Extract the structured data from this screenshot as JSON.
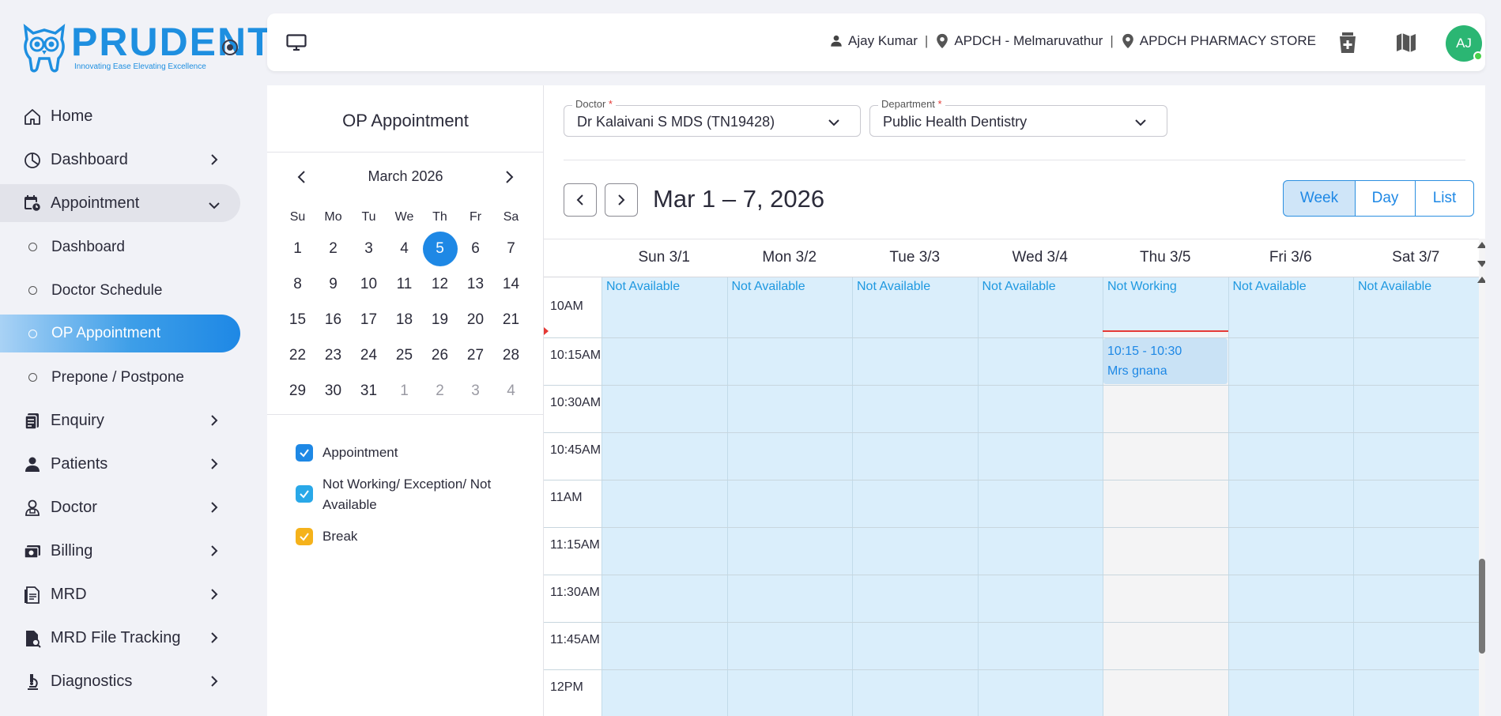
{
  "brand": {
    "name": "PRUDENT",
    "tagline": "Innovating Ease Elevating Excellence",
    "color": "#1e8fe0"
  },
  "sidebar": {
    "items": [
      {
        "label": "Home",
        "icon": "home-icon"
      },
      {
        "label": "Dashboard",
        "icon": "pie-chart-icon"
      },
      {
        "label": "Appointment",
        "icon": "calendar-clock-icon",
        "open": true
      },
      {
        "label": "Enquiry",
        "icon": "enquiry-icon"
      },
      {
        "label": "Patients",
        "icon": "person-icon"
      },
      {
        "label": "Doctor",
        "icon": "doctor-icon"
      },
      {
        "label": "Billing",
        "icon": "billing-icon"
      },
      {
        "label": "MRD",
        "icon": "document-icon"
      },
      {
        "label": "MRD File Tracking",
        "icon": "file-search-icon"
      },
      {
        "label": "Diagnostics",
        "icon": "microscope-icon"
      }
    ],
    "sub_items": [
      {
        "label": "Dashboard"
      },
      {
        "label": "Doctor Schedule"
      },
      {
        "label": "OP Appointment",
        "active": true
      },
      {
        "label": "Prepone / Postpone"
      }
    ]
  },
  "topbar": {
    "user": "Ajay Kumar",
    "branch": "APDCH - Melmaruvathur",
    "store": "APDCH PHARMACY STORE",
    "avatar_initials": "AJ",
    "avatar_color": "#2bb673"
  },
  "leftpanel": {
    "title": "OP Appointment",
    "month_label": "March 2026",
    "dow": [
      "Su",
      "Mo",
      "Tu",
      "We",
      "Th",
      "Fr",
      "Sa"
    ],
    "weeks": [
      [
        {
          "d": "1"
        },
        {
          "d": "2"
        },
        {
          "d": "3"
        },
        {
          "d": "4"
        },
        {
          "d": "5",
          "sel": true
        },
        {
          "d": "6"
        },
        {
          "d": "7"
        }
      ],
      [
        {
          "d": "8"
        },
        {
          "d": "9"
        },
        {
          "d": "10"
        },
        {
          "d": "11"
        },
        {
          "d": "12"
        },
        {
          "d": "13"
        },
        {
          "d": "14"
        }
      ],
      [
        {
          "d": "15"
        },
        {
          "d": "16"
        },
        {
          "d": "17"
        },
        {
          "d": "18"
        },
        {
          "d": "19"
        },
        {
          "d": "20"
        },
        {
          "d": "21"
        }
      ],
      [
        {
          "d": "22"
        },
        {
          "d": "23"
        },
        {
          "d": "24"
        },
        {
          "d": "25"
        },
        {
          "d": "26"
        },
        {
          "d": "27"
        },
        {
          "d": "28"
        }
      ],
      [
        {
          "d": "29"
        },
        {
          "d": "30"
        },
        {
          "d": "31"
        },
        {
          "d": "1",
          "muted": true
        },
        {
          "d": "2",
          "muted": true
        },
        {
          "d": "3",
          "muted": true
        },
        {
          "d": "4",
          "muted": true
        }
      ]
    ],
    "legend": [
      {
        "label": "Appointment",
        "color": "#1e88e5"
      },
      {
        "label": "Not Working/ Exception/ Not Available",
        "color": "#29a8e8"
      },
      {
        "label": "Break",
        "color": "#f5b21b"
      }
    ]
  },
  "filters": {
    "doctor_label": "Doctor",
    "doctor_value": "Dr Kalaivani S  MDS (TN19428)",
    "department_label": "Department",
    "department_value": "Public Health Dentistry",
    "required_mark": "*"
  },
  "calendar": {
    "range_title": "Mar 1 – 7, 2026",
    "views": [
      "Week",
      "Day",
      "List"
    ],
    "active_view": "Week",
    "days": [
      {
        "label": "Sun 3/1",
        "status": "Not Available"
      },
      {
        "label": "Mon 3/2",
        "status": "Not Available"
      },
      {
        "label": "Tue 3/3",
        "status": "Not Available"
      },
      {
        "label": "Wed 3/4",
        "status": "Not Available"
      },
      {
        "label": "Thu 3/5",
        "status": "Not Working"
      },
      {
        "label": "Fri 3/6",
        "status": "Not Available"
      },
      {
        "label": "Sat 3/7",
        "status": "Not Available"
      }
    ],
    "times": [
      "10AM",
      "10:15AM",
      "10:30AM",
      "10:45AM",
      "11AM",
      "11:15AM",
      "11:30AM",
      "11:45AM",
      "12PM"
    ],
    "event": {
      "time": "10:15 - 10:30",
      "title": "Mrs gnana",
      "day_index": 4
    },
    "accent": "#1e88e5"
  }
}
